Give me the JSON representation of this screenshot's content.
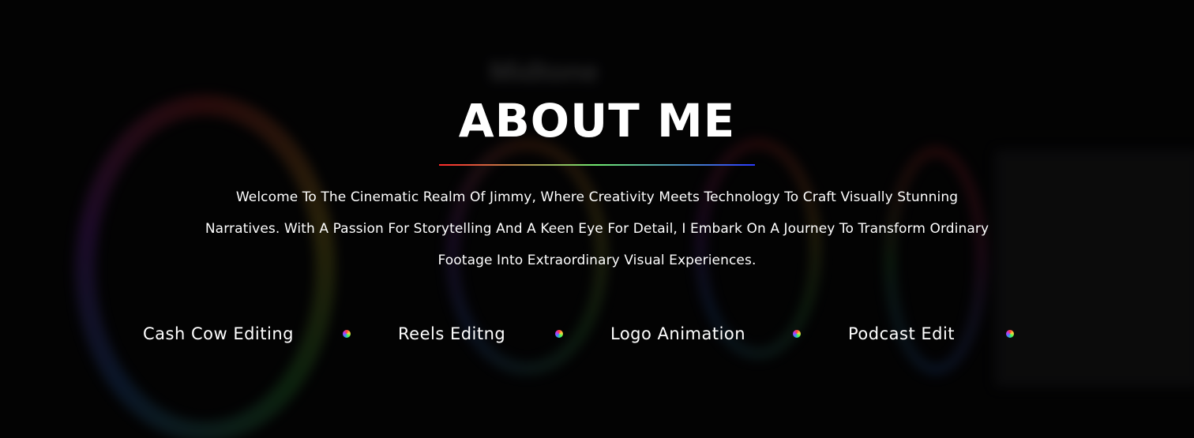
{
  "about": {
    "title": "ABOUT ME",
    "intro": "Welcome To The Cinematic Realm Of Jimmy, Where Creativity Meets Technology To Craft Visually Stunning Narratives. With A Passion For Storytelling And A Keen Eye For Detail, I Embark On A Journey To Transform Ordinary Footage Into Extraordinary Visual Experiences."
  },
  "background": {
    "ghost_labels": [
      "Midtone"
    ]
  },
  "services": [
    {
      "label": "Cash Cow Editing"
    },
    {
      "label": "Reels Editng"
    },
    {
      "label": "Logo Animation"
    },
    {
      "label": "Podcast Edit"
    }
  ],
  "colors": {
    "background": "#050506",
    "text": "#ffffff",
    "underline_gradient": [
      "#ff2a2a",
      "#6fe86f",
      "#2b3bff"
    ]
  },
  "icons": {
    "service_separator": "rainbow-dot-icon"
  }
}
